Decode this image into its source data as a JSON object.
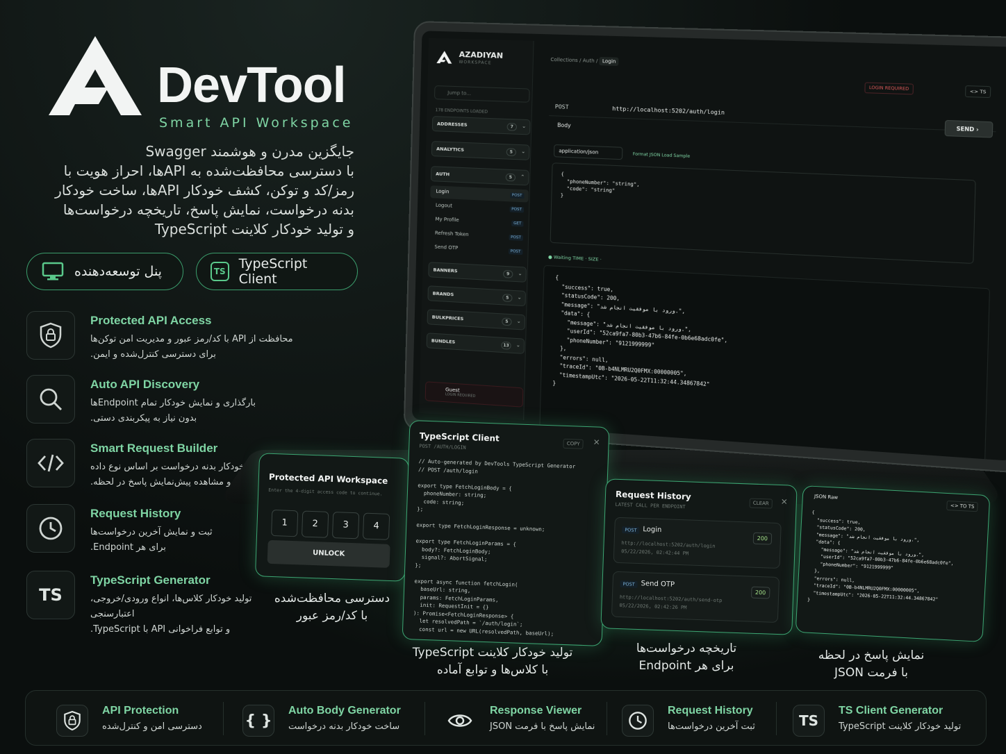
{
  "brand": {
    "name": "DevTool",
    "tagline": "Smart API Workspace"
  },
  "intro": [
    "جایگزین مدرن و هوشمند Swagger",
    "با دسترسی محافظت‌شده به APIها، احراز هویت با",
    "رمز/کد و توکن، کشف خودکار APIها، ساخت خودکار",
    "بدنه درخواست، نمایش پاسخ، تاریخچه درخواست‌ها",
    "و تولید خودکار کلاینت TypeScript"
  ],
  "pills": {
    "dev_panel": "پنل توسعه‌دهنده",
    "ts_client": "TypeScript Client"
  },
  "features": [
    {
      "title": "Protected API Access",
      "line1": "محافظت از API با کد/رمز عبور و مدیریت امن توکن‌ها",
      "line2": "برای دسترسی کنترل‌شده و ایمن.",
      "icon": "shield-lock-icon"
    },
    {
      "title": "Auto API Discovery",
      "line1": "بارگذاری و نمایش خودکار تمام Endpointها",
      "line2": "بدون نیاز به پیکربندی دستی.",
      "icon": "search-icon"
    },
    {
      "title": "Smart Request Builder",
      "line1": "ساخت خودکار بدنه درخواست بر اساس نوع داده",
      "line2": "و مشاهده پیش‌نمایش پاسخ در لحظه.",
      "icon": "code-icon"
    },
    {
      "title": "Request History",
      "line1": "ثبت و نمایش آخرین درخواست‌ها",
      "line2": "برای هر Endpoint.",
      "icon": "clock-icon"
    },
    {
      "title": "TypeScript Generator",
      "line1": "تولید خودکار کلاس‌ها، انواع ورودی/خروجی، اعتبارسنجی",
      "line2": "و توابع فراخوانی API با TypeScript.",
      "icon": "ts-icon"
    }
  ],
  "app": {
    "ws_name": "AZADIYAN",
    "ws_sub": "WORKSPACE",
    "jump": "Jump to...",
    "loaded": "178 ENDPOINTS LOADED",
    "groups": [
      {
        "name": "ADDRESSES",
        "count": "7"
      },
      {
        "name": "ANALYTICS",
        "count": "5"
      },
      {
        "name": "AUTH",
        "count": "5"
      },
      {
        "name": "BANNERS",
        "count": "9"
      },
      {
        "name": "BRANDS",
        "count": "5"
      },
      {
        "name": "BULKPRICES",
        "count": "5"
      },
      {
        "name": "BUNDLES",
        "count": "13"
      }
    ],
    "endpoints": [
      {
        "name": "Login",
        "method": "POST"
      },
      {
        "name": "Logout",
        "method": "POST"
      },
      {
        "name": "My Profile",
        "method": "GET"
      },
      {
        "name": "Refresh Token",
        "method": "POST"
      },
      {
        "name": "Send OTP",
        "method": "POST"
      }
    ],
    "guest": "Guest",
    "guest_sub": "LOGIN REQUIRED",
    "crumb_a": "Collections",
    "crumb_b": "Auth",
    "crumb_c": "Login",
    "login_req": "LOGIN REQUIRED",
    "ts_btn": "<> TS",
    "method": "POST",
    "url": "http://localhost:5202/auth/login",
    "send": "SEND",
    "body": "Body",
    "content_type": "application/json",
    "format": "Format JSON   Load Sample",
    "request_body": "{\n  \"phoneNumber\": \"string\",\n  \"code\": \"string\"\n}",
    "status": "● Waiting   TIME  ·  SIZE  ·",
    "resp_tabs": "JSON   Raw",
    "response": "{\n  \"success\": true,\n  \"statusCode\": 200,\n  \"message\": \"ورود با موفقیت انجام شد.\",\n  \"data\": {\n    \"message\": \"ورود با موفقیت انجام شد.\",\n    \"userId\": \"52ca9fa7-80b3-47b6-84fe-0b6e68adc0fe\",\n    \"phoneNumber\": \"9121999999\"\n  },\n  \"errors\": null,\n  \"traceId\": \"0B-b4NLMRU2Q0FMX:00000005\",\n  \"timestampUtc\": \"2026-05-22T11:32:44.34867842\"\n}"
  },
  "cards": {
    "pin": {
      "title": "Protected API Workspace",
      "sub": "Enter the 4-digit access code to continue.",
      "digits": [
        "1",
        "2",
        "3",
        "4"
      ],
      "unlock": "UNLOCK",
      "caption1": "دسترسی محافظت‌شده",
      "caption2": "با کد/رمز عبور"
    },
    "ts": {
      "title": "TypeScript Client",
      "sub": "POST /AUTH/LOGIN",
      "copy": "COPY",
      "code": "// Auto-generated by DevTools TypeScript Generator\n// POST /auth/login\n\nexport type FetchLoginBody = {\n  phoneNumber: string;\n  code: string;\n};\n\nexport type FetchLoginResponse = unknown;\n\nexport type FetchLoginParams = {\n  body?: FetchLoginBody;\n  signal?: AbortSignal;\n};\n\nexport async function fetchLogin(\n  baseUrl: string,\n  params: FetchLoginParams,\n  init: RequestInit = {}\n): Promise<FetchLoginResponse> {\n  let resolvedPath = `/auth/login`;\n  const url = new URL(resolvedPath, baseUrl);",
      "caption1": "تولید خودکار کلاینت TypeScript",
      "caption2": "با کلاس‌ها و توابع آماده"
    },
    "hist": {
      "title": "Request History",
      "sub": "LATEST CALL PER ENDPOINT",
      "clear": "CLEAR",
      "items": [
        {
          "method": "POST",
          "name": "Login",
          "url": "http://localhost:5202/auth/login",
          "time": "05/22/2026, 02:42:44 PM",
          "status": "200"
        },
        {
          "method": "POST",
          "name": "Send OTP",
          "url": "http://localhost:5202/auth/send-otp",
          "time": "05/22/2026, 02:42:26 PM",
          "status": "200"
        }
      ],
      "caption1": "تاریخچه درخواست‌ها",
      "caption2": "برای هر Endpoint"
    },
    "json": {
      "tabs": "JSON   Raw",
      "ts": "<> TO TS",
      "caption1": "نمایش پاسخ در لحظه",
      "caption2": "با فرمت JSON"
    }
  },
  "bottom": [
    {
      "title": "API Protection",
      "desc": "دسترسی امن و کنترل‌شده",
      "icon": "shield-lock-icon"
    },
    {
      "title": "Auto Body Generator",
      "desc": "ساخت خودکار بدنه درخواست",
      "icon": "braces-icon"
    },
    {
      "title": "Response Viewer",
      "desc": "نمایش پاسخ با فرمت JSON",
      "icon": "eye-icon"
    },
    {
      "title": "Request History",
      "desc": "ثبت آخرین درخواست‌ها",
      "icon": "clock-icon"
    },
    {
      "title": "TS Client Generator",
      "desc": "تولید خودکار کلاینت TypeScript",
      "icon": "ts-icon"
    }
  ]
}
